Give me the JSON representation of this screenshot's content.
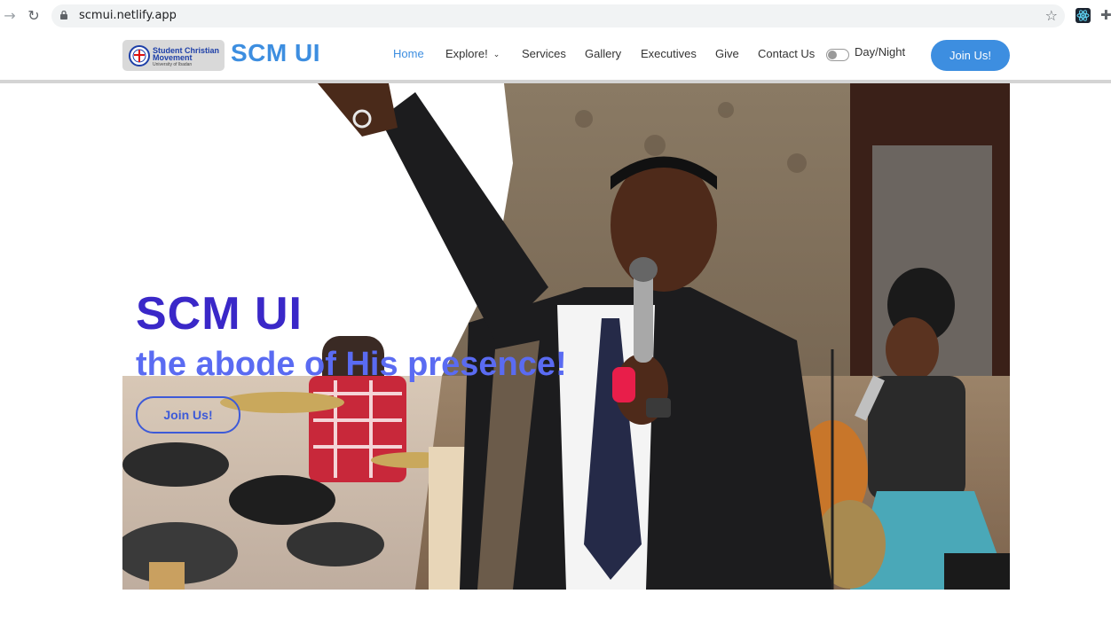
{
  "browser": {
    "url": "scmui.netlify.app",
    "icons": [
      "back-arrow-icon",
      "reload-icon",
      "lock-icon",
      "star-icon",
      "react-devtools-icon",
      "puzzle-icon"
    ]
  },
  "header": {
    "logo": {
      "org_line1": "Student Christian",
      "org_line2": "Movement",
      "org_sub": "University of Ibadan"
    },
    "brand": "SCM UI",
    "nav": {
      "home": "Home",
      "explore": "Explore!",
      "services": "Services",
      "gallery": "Gallery",
      "executives": "Executives",
      "give": "Give",
      "contact": "Contact Us"
    },
    "toggle_label": "Day/Night",
    "toggle_on": false,
    "join_label": "Join Us!"
  },
  "hero": {
    "title": "SCM UI",
    "tagline": "the abode of His presence!",
    "join_label": "Join Us!"
  },
  "colors": {
    "accent": "#3d8ee0",
    "hero_title": "#3a28c8",
    "hero_tagline": "#5a6bf2"
  }
}
